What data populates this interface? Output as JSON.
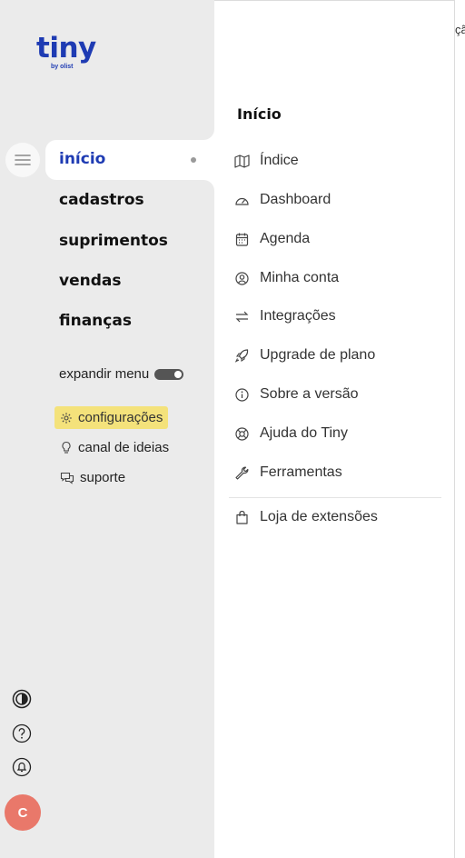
{
  "app": {
    "logo_text": "tiny",
    "logo_sub": "by olist"
  },
  "sidebar": {
    "nav": [
      {
        "label": "início",
        "active": true
      },
      {
        "label": "cadastros"
      },
      {
        "label": "suprimentos"
      },
      {
        "label": "vendas"
      },
      {
        "label": "finanças"
      }
    ],
    "expand_label": "expandir menu",
    "utilities": [
      {
        "label": "configurações",
        "icon": "gear-icon",
        "highlighted": true
      },
      {
        "label": "canal de ideias",
        "icon": "lightbulb-icon"
      },
      {
        "label": "suporte",
        "icon": "chat-icon"
      }
    ],
    "bottom_icons": [
      "contrast-icon",
      "help-icon",
      "bell-icon"
    ],
    "avatar_initial": "C"
  },
  "panel": {
    "title": "Início",
    "items": [
      {
        "label": "Índice",
        "icon": "map-icon"
      },
      {
        "label": "Dashboard",
        "icon": "gauge-icon"
      },
      {
        "label": "Agenda",
        "icon": "calendar-icon"
      },
      {
        "label": "Minha conta",
        "icon": "user-circle-icon"
      },
      {
        "label": "Integrações",
        "icon": "arrows-icon"
      },
      {
        "label": "Upgrade de plano",
        "icon": "rocket-icon"
      },
      {
        "label": "Sobre a versão",
        "icon": "info-icon"
      },
      {
        "label": "Ajuda do Tiny",
        "icon": "lifebuoy-icon"
      },
      {
        "label": "Ferramentas",
        "icon": "wrench-icon"
      }
    ],
    "extra_item": {
      "label": "Loja de extensões",
      "icon": "bag-icon"
    }
  },
  "right_pane": {
    "partial_text": "ção"
  },
  "colors": {
    "brand_blue": "#1e3bb3",
    "sidebar_bg": "#ebebeb",
    "highlight": "#f4e27b",
    "avatar": "#e9786a"
  }
}
